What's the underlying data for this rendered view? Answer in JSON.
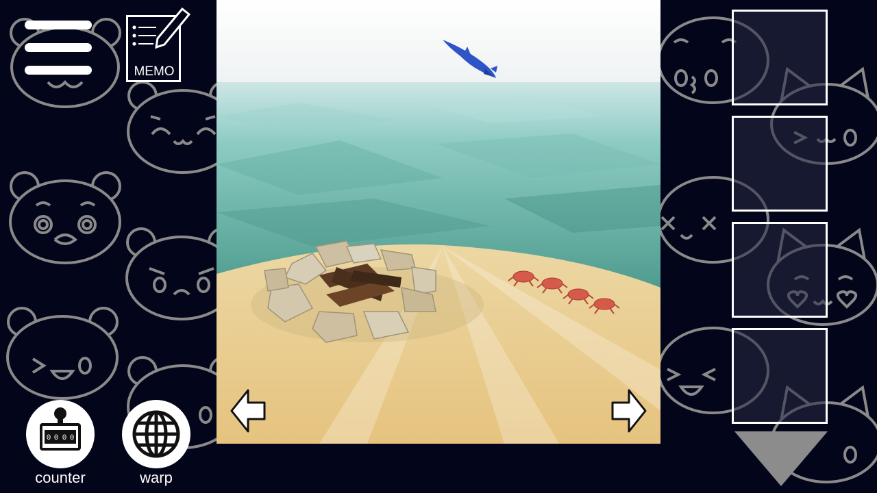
{
  "menu": {
    "icon": "hamburger-menu-icon"
  },
  "memo": {
    "label": "MEMO",
    "icon": "memo-pencil-icon"
  },
  "tools": {
    "counter": {
      "label": "counter",
      "icon": "counter-icon",
      "digits": "0000"
    },
    "warp": {
      "label": "warp",
      "icon": "globe-icon"
    }
  },
  "scene": {
    "description_icons": [
      "dolphin",
      "campfire",
      "crab"
    ],
    "nav_left_icon": "arrow-left-icon",
    "nav_right_icon": "arrow-right-icon"
  },
  "inventory": {
    "slots": [
      {
        "item": ""
      },
      {
        "item": ""
      },
      {
        "item": ""
      },
      {
        "item": ""
      }
    ],
    "scroll_icon": "triangle-down-icon"
  },
  "colors": {
    "background": "#03051a",
    "decor_line": "#8a8a8a",
    "sky": "#f4f6f6",
    "sea": "#6fb8ad",
    "sand": "#e9cf93"
  }
}
